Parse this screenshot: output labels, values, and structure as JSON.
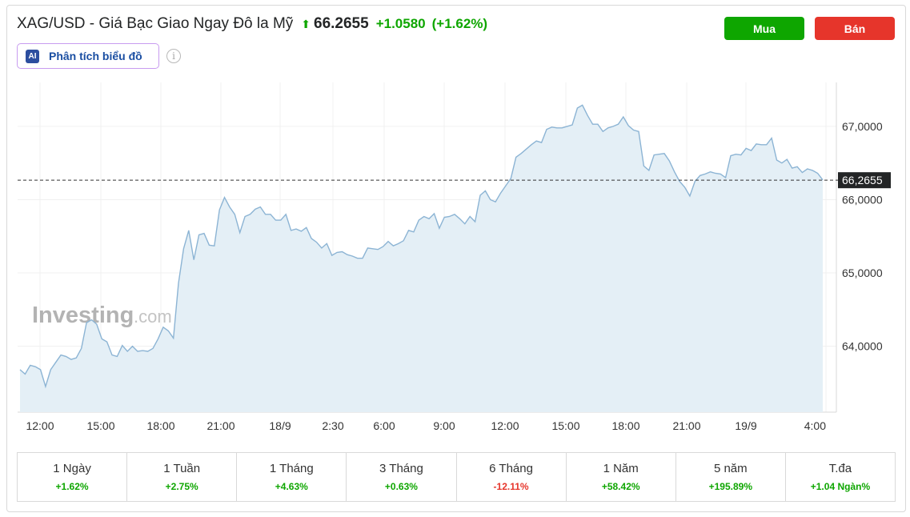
{
  "header": {
    "instrument": "XAG/USD - Giá Bạc Giao Ngay Đô la Mỹ",
    "arrow_icon": "up-arrow-icon",
    "price": "66.2655",
    "change": "+1.0580",
    "change_pct": "(+1.62%)",
    "positive_color": "#0ea600"
  },
  "ai_button": {
    "icon_text": "AI",
    "label": "Phân tích biểu đồ"
  },
  "info_icon": "i",
  "actions": {
    "buy_label": "Mua",
    "sell_label": "Bán",
    "buy_color": "#0ea600",
    "sell_color": "#e6352b"
  },
  "watermark": {
    "brand": "Investing",
    "suffix": ".com"
  },
  "chart_data": {
    "type": "area",
    "ylim": [
      63.1,
      67.6
    ],
    "y_ticks": [
      "67,0000",
      "66,0000",
      "65,0000",
      "64,0000"
    ],
    "y_tick_values": [
      67,
      66,
      65,
      64
    ],
    "x_tick_labels": [
      "12:00",
      "15:00",
      "18:00",
      "21:00",
      "18/9",
      "2:30",
      "6:00",
      "9:00",
      "12:00",
      "15:00",
      "18:00",
      "21:00",
      "19/9",
      "4:00"
    ],
    "current_price_label": "66,2655",
    "current_price": 66.2655,
    "line_color": "#8cb4d4",
    "fill_color": "#e4eff6",
    "values": [
      63.68,
      63.62,
      63.74,
      63.72,
      63.68,
      63.45,
      63.68,
      63.78,
      63.88,
      63.86,
      63.82,
      63.84,
      63.97,
      64.32,
      64.36,
      64.3,
      64.1,
      64.06,
      63.88,
      63.86,
      64.01,
      63.93,
      64.0,
      63.93,
      63.94,
      63.93,
      63.97,
      64.1,
      64.26,
      64.21,
      64.11,
      64.86,
      65.33,
      65.58,
      65.18,
      65.52,
      65.54,
      65.38,
      65.37,
      65.86,
      66.03,
      65.9,
      65.8,
      65.55,
      65.77,
      65.8,
      65.87,
      65.9,
      65.8,
      65.8,
      65.72,
      65.72,
      65.8,
      65.58,
      65.6,
      65.57,
      65.62,
      65.47,
      65.42,
      65.34,
      65.4,
      65.24,
      65.28,
      65.29,
      65.25,
      65.23,
      65.2,
      65.2,
      65.34,
      65.33,
      65.32,
      65.36,
      65.43,
      65.37,
      65.4,
      65.44,
      65.58,
      65.56,
      65.72,
      65.77,
      65.74,
      65.81,
      65.61,
      65.76,
      65.77,
      65.8,
      65.74,
      65.67,
      65.77,
      65.7,
      66.06,
      66.12,
      66.0,
      65.97,
      66.09,
      66.19,
      66.29,
      66.58,
      66.63,
      66.69,
      66.75,
      66.8,
      66.78,
      66.96,
      66.99,
      66.98,
      66.98,
      67.0,
      67.02,
      67.25,
      67.29,
      67.15,
      67.03,
      67.03,
      66.93,
      66.98,
      67.0,
      67.03,
      67.13,
      67.01,
      66.95,
      66.93,
      66.46,
      66.4,
      66.61,
      66.62,
      66.63,
      66.53,
      66.38,
      66.25,
      66.17,
      66.05,
      66.25,
      66.33,
      66.35,
      66.38,
      66.36,
      66.35,
      66.3,
      66.6,
      66.62,
      66.61,
      66.7,
      66.67,
      66.76,
      66.75,
      66.75,
      66.84,
      66.54,
      66.5,
      66.55,
      66.43,
      66.45,
      66.37,
      66.42,
      66.4,
      66.36,
      66.27
    ],
    "performance": [
      {
        "period": "1 Ngày",
        "value": "+1.62%",
        "sign": "pos"
      },
      {
        "period": "1 Tuần",
        "value": "+2.75%",
        "sign": "pos"
      },
      {
        "period": "1 Tháng",
        "value": "+4.63%",
        "sign": "pos"
      },
      {
        "period": "3 Tháng",
        "value": "+0.63%",
        "sign": "pos"
      },
      {
        "period": "6 Tháng",
        "value": "-12.11%",
        "sign": "neg"
      },
      {
        "period": "1 Năm",
        "value": "+58.42%",
        "sign": "pos"
      },
      {
        "period": "5 năm",
        "value": "+195.89%",
        "sign": "pos"
      },
      {
        "period": "T.đa",
        "value": "+1.04 Ngàn%",
        "sign": "pos"
      }
    ]
  }
}
